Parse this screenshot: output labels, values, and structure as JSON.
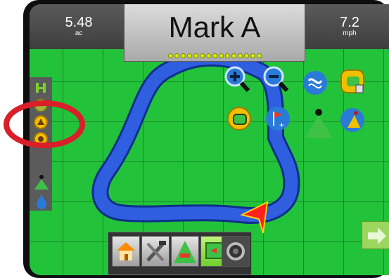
{
  "header": {
    "area": {
      "value": "5.48",
      "unit": "ac"
    },
    "speed": {
      "value": "7.2",
      "unit": "mph"
    },
    "title": "Mark A",
    "progress_dots": 15
  },
  "sidebar": {
    "items": [
      "boom-section-icon",
      "mark-a-icon",
      "mark-icon",
      "mark-b-icon",
      "vehicle-icon",
      "droplet-icon"
    ]
  },
  "map_tools": {
    "row1": [
      "zoom-in-icon",
      "zoom-out-icon",
      "pan-guidelines-icon",
      "delete-boundary-icon"
    ],
    "row2": [
      "boundary-icon",
      "add-marker-icon",
      "vehicle-view-icon",
      "bird-eye-view-icon"
    ]
  },
  "bottom_nav": [
    "home-icon",
    "tools-icon",
    "vehicle-view-icon",
    "field-view-icon",
    "real-view-icon"
  ],
  "colors": {
    "field": "#22c23a",
    "path": "#2f5fe0",
    "bezel": "#0e0e0e",
    "callout": "#d81f2a",
    "vehicle_marker": "#ff2020"
  }
}
